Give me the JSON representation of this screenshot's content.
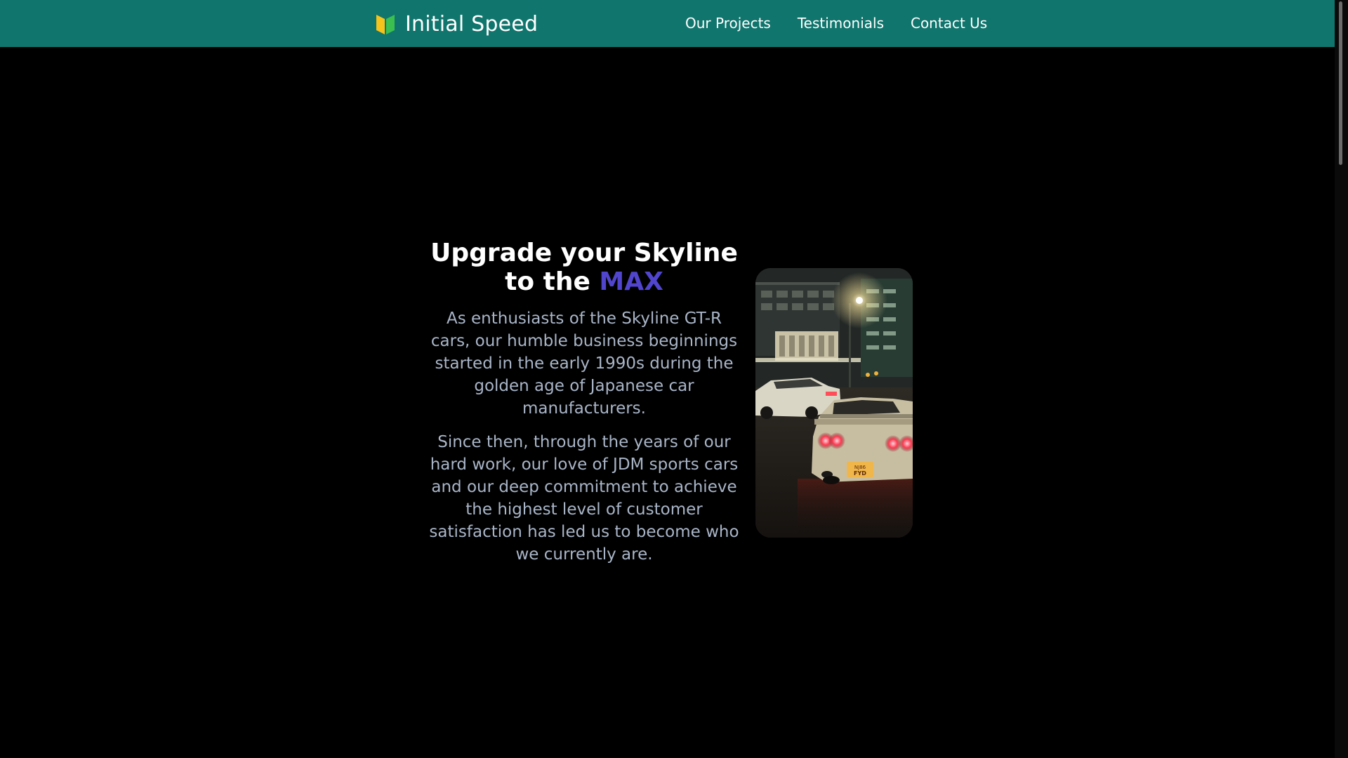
{
  "navbar": {
    "brand_icon": "wakaba-leaf-icon",
    "brand_name": "Initial Speed",
    "links": [
      {
        "label": "Our Projects"
      },
      {
        "label": "Testimonials"
      },
      {
        "label": "Contact Us"
      }
    ]
  },
  "hero": {
    "title_main": "Upgrade your Skyline to the ",
    "title_accent": "MAX",
    "paragraphs": [
      "As enthusiasts of the Skyline GT-R cars, our humble business beginnings started in the early 1990s during the golden age of Japanese car manufacturers.",
      "Since then, through the years of our hard work, our love of JDM sports cars and our deep commitment to achieve the highest level of customer satisfaction has led us to become who we currently are."
    ],
    "image": {
      "plate_line1": "NJ86",
      "plate_line2": "FYD"
    }
  },
  "colors": {
    "navbar_bg": "#10756d",
    "page_bg": "#000000",
    "accent": "#5145cd",
    "body_text": "#a9b5c8"
  }
}
